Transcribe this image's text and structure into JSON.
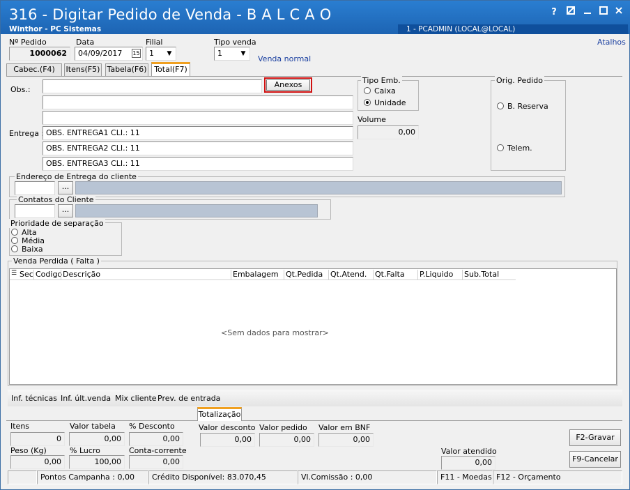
{
  "window": {
    "title": "316 - Digitar Pedido de Venda - B A L C A O",
    "subtitle": "Winthor - PC Sistemas",
    "user": "1 - PCADMIN (LOCAL@LOCAL)",
    "help_label": "?"
  },
  "header": {
    "pedido_label": "Nº Pedido",
    "pedido_value": "1000062",
    "data_label": "Data",
    "data_value": "04/09/2017",
    "filial_label": "Filial",
    "filial_value": "1",
    "tipo_venda_label": "Tipo venda",
    "tipo_venda_value": "1",
    "tipo_venda_desc": "Venda normal",
    "atalhos": "Atalhos"
  },
  "tabs": [
    {
      "label": "Cabec.(F4)"
    },
    {
      "label": "Itens(F5)"
    },
    {
      "label": "Tabela(F6)"
    },
    {
      "label": "Total(F7)"
    }
  ],
  "obs": {
    "label": "Obs.:",
    "anexos_label": "Anexos",
    "entrega_label": "Entrega :",
    "entrega_lines": [
      "OBS. ENTREGA1 CLI.: 11",
      "OBS. ENTREGA2 CLI.: 11",
      "OBS. ENTREGA3 CLI.: 11"
    ]
  },
  "tipo_emb": {
    "title": "Tipo Emb.",
    "options": [
      "Caixa",
      "Unidade"
    ],
    "selected": "Unidade",
    "volume_label": "Volume",
    "volume_value": "0,00"
  },
  "orig_pedido": {
    "title": "Orig. Pedido",
    "options": [
      "B. Reserva",
      "Telem."
    ]
  },
  "endereco": {
    "title": "Endereço de Entrega do cliente",
    "button": "..."
  },
  "contatos": {
    "title": "Contatos do Cliente",
    "button": "..."
  },
  "prioridade": {
    "title": "Prioridade de separação",
    "options": [
      "Alta",
      "Média",
      "Baixa"
    ]
  },
  "venda_perdida": {
    "title": "Venda Perdida ( Falta )",
    "columns": [
      "Sec",
      "Codigo",
      "Descrição",
      "Embalagem",
      "Qt.Pedida",
      "Qt.Atend.",
      "Qt.Falta",
      "P.Liquido",
      "Sub.Total"
    ],
    "empty_text": "<Sem dados para mostrar>"
  },
  "links": [
    "Inf. técnicas",
    "Inf. últ.venda",
    "Mix cliente",
    "Prev. de entrada"
  ],
  "totalizacao": {
    "tab_label": "Totalização",
    "itens_label": "Itens",
    "itens_value": "0",
    "valor_tabela_label": "Valor tabela",
    "valor_tabela_value": "0,00",
    "pct_desconto_label": "% Desconto",
    "pct_desconto_value": "0,00",
    "valor_desconto_label": "Valor desconto",
    "valor_desconto_value": "0,00",
    "valor_pedido_label": "Valor pedido",
    "valor_pedido_value": "0,00",
    "valor_bnf_label": "Valor em BNF",
    "valor_bnf_value": "0,00",
    "peso_label": "Peso (Kg)",
    "peso_value": "0,00",
    "pct_lucro_label": "% Lucro",
    "pct_lucro_value": "100,00",
    "conta_corrente_label": "Conta-corrente",
    "conta_corrente_value": "0,00",
    "valor_atendido_label": "Valor atendido",
    "valor_atendido_value": "0,00"
  },
  "buttons": {
    "gravar": "F2-Gravar",
    "cancelar": "F9-Cancelar"
  },
  "status": {
    "pontos": "Pontos Campanha : 0,00",
    "credito": "Crédito Disponível: 83.070,45",
    "comissao": "Vl.Comissão : 0,00",
    "moedas": "F11 - Moedas",
    "orcamento": "F12 - Orçamento"
  }
}
